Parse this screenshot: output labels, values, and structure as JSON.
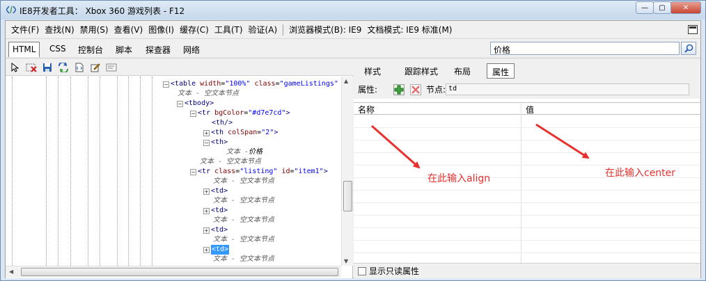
{
  "window": {
    "title": "IE8开发者工具： Xbox 360 游戏列表 - F12",
    "min": "—",
    "max": "▢",
    "close": "✕"
  },
  "menu": [
    "文件(F)",
    "查找(N)",
    "禁用(S)",
    "查看(V)",
    "图像(I)",
    "缓存(C)",
    "工具(T)",
    "验证(A)"
  ],
  "browser_mode": "浏览器模式(B): IE9",
  "doc_mode": "文档模式: IE9 标准(M)",
  "tabs": [
    "HTML",
    "CSS",
    "控制台",
    "脚本",
    "探查器",
    "网络"
  ],
  "search": {
    "value": "价格"
  },
  "tree": {
    "l0_tag": "<table",
    "l0_a1": "width",
    "l0_v1": "\"100%\"",
    "l0_a2": "class",
    "l0_v2": "\"gameListings\"",
    "l0_more": ":",
    "t_empty": "文本 - 空文本节点",
    "tbody": "<tbody>",
    "tr1_tag": "<tr",
    "tr1_a": "bgColor",
    "tr1_v": "\"#d7e7cd\"",
    "close_gt": ">",
    "th_self": "<th/>",
    "th_cs_tag": "<th",
    "th_cs_a": "colSpan",
    "th_cs_v": "\"2\"",
    "th_open": "<th>",
    "t_price_prefix": "文本 - ",
    "t_price": "价格",
    "tr2_tag": "<tr",
    "tr2_a1": "class",
    "tr2_v1": "\"listing\"",
    "tr2_a2": "id",
    "tr2_v2": "\"item1\"",
    "td": "<td>"
  },
  "right_tabs": [
    "样式",
    "跟踪样式",
    "布局",
    "属性"
  ],
  "props": {
    "label": "属性:",
    "node_label": "节点:",
    "node_value": "td"
  },
  "grid": {
    "col_name": "名称",
    "col_value": "值"
  },
  "annotations": {
    "left": "在此输入align",
    "right": "在此输入center"
  },
  "readonly_label": "显示只读属性",
  "colors": {
    "annotation": "#e8312e",
    "selection": "#3399ff",
    "tag": "#000080",
    "attr": "#800000",
    "value": "#0000ff"
  }
}
